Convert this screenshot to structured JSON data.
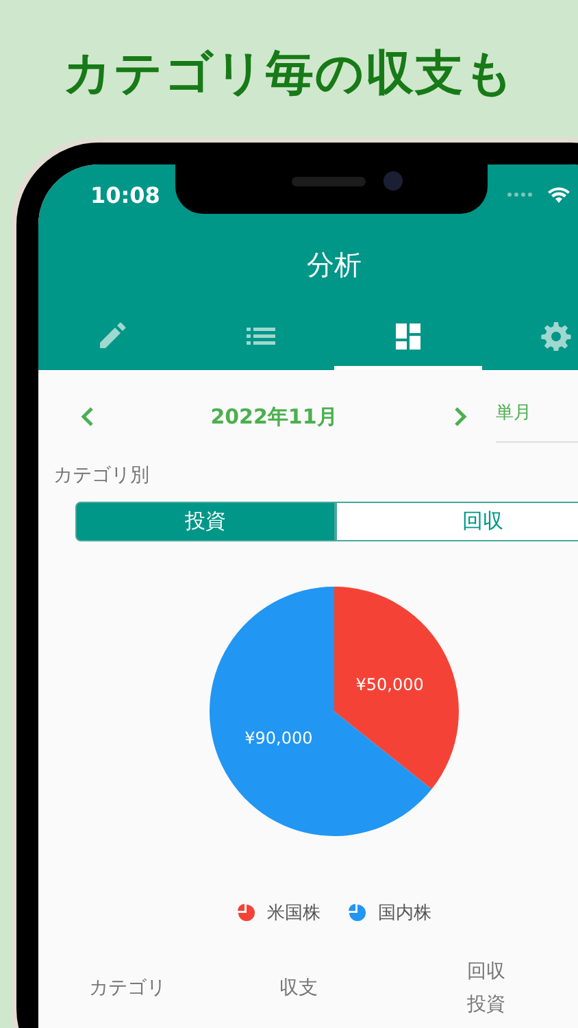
{
  "headline": "カテゴリ毎の収支も",
  "status_bar": {
    "time": "10:08"
  },
  "app_bar": {
    "title": "分析"
  },
  "tabs": [
    {
      "kind": "pencil",
      "selected": false
    },
    {
      "kind": "list",
      "selected": false
    },
    {
      "kind": "dashboard",
      "selected": true
    },
    {
      "kind": "gear",
      "selected": false
    }
  ],
  "period": {
    "label": "2022年11月",
    "mode": "単月"
  },
  "section_label": "カテゴリ別",
  "segments": [
    {
      "label": "投資",
      "selected": true
    },
    {
      "label": "回収",
      "selected": false
    }
  ],
  "chart": {
    "chart_data": {
      "type": "pie",
      "categories": [
        "米国株",
        "国内株"
      ],
      "values": [
        50000,
        90000
      ],
      "value_labels": [
        "¥50,000",
        "¥90,000"
      ]
    }
  },
  "legend": [
    {
      "color": "#f44336"
    },
    {
      "color": "#2196f3"
    }
  ],
  "table": {
    "columns": [
      {
        "lines": [
          "カテゴリ"
        ]
      },
      {
        "lines": [
          "収支"
        ]
      },
      {
        "lines": [
          "回収",
          "投資"
        ]
      }
    ]
  }
}
